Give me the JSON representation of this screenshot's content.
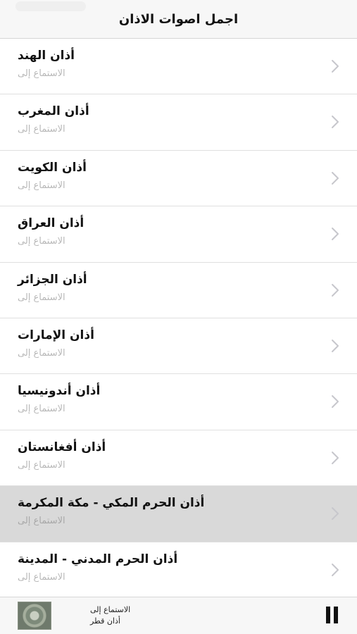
{
  "header": {
    "title": "اجمل اصوات الاذان"
  },
  "list": {
    "items": [
      {
        "title": "أذان الهند",
        "subtitle": "الاستماع إلى"
      },
      {
        "title": "أذان المغرب",
        "subtitle": "الاستماع إلى"
      },
      {
        "title": "أذان الكويت",
        "subtitle": "الاستماع إلى"
      },
      {
        "title": "أذان العراق",
        "subtitle": "الاستماع إلى"
      },
      {
        "title": "أذان الجزائر",
        "subtitle": "الاستماع إلى"
      },
      {
        "title": "أذان الإمارات",
        "subtitle": "الاستماع إلى"
      },
      {
        "title": "أذان أندونيسيا",
        "subtitle": "الاستماع إلى"
      },
      {
        "title": "أذان أفغانستان",
        "subtitle": "الاستماع إلى"
      },
      {
        "title": "أذان الحرم المكي -  مكة المكرمة",
        "subtitle": "الاستماع إلى"
      },
      {
        "title": "أذان الحرم المدني -  المدينة",
        "subtitle": "الاستماع إلى"
      }
    ],
    "selected_index": 8,
    "row_icon": "chevron-right-icon"
  },
  "player": {
    "label": "الاستماع إلى",
    "track": "أذان قطر",
    "art_icon": "islamic-pattern-artwork",
    "control_icon": "pause-icon"
  },
  "colors": {
    "nav_bg": "#f7f7f7",
    "selected_row": "#d9d9d9",
    "subtitle": "#b8b8b8",
    "chevron": "#c7c7cc"
  }
}
